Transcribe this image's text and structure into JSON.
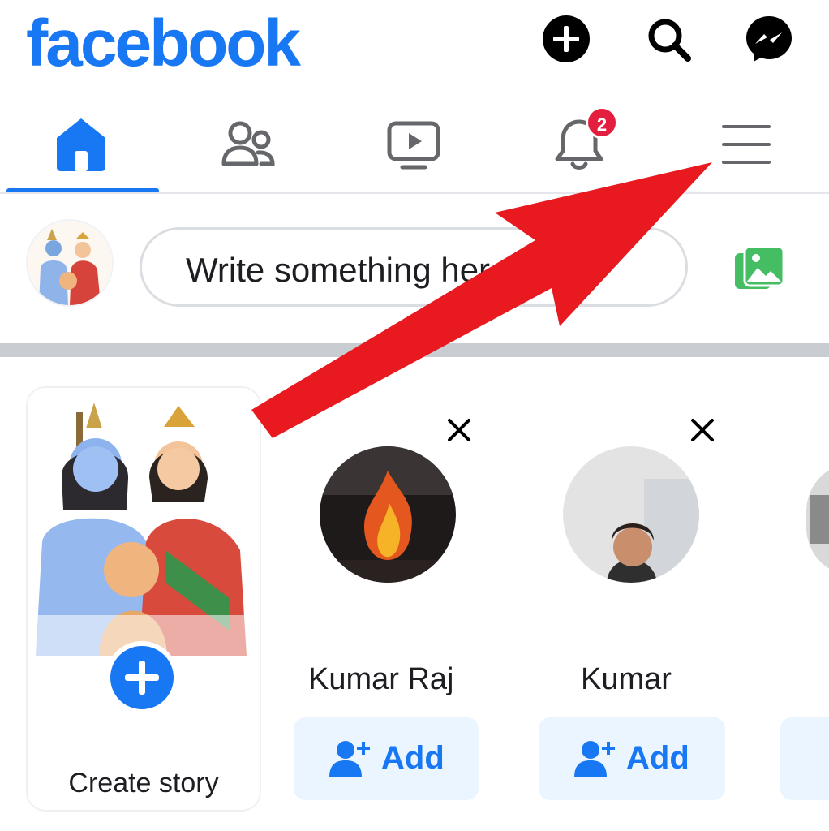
{
  "header": {
    "logo_text": "facebook",
    "create_icon": "plus-circle-icon",
    "search_icon": "search-icon",
    "messenger_icon": "messenger-icon"
  },
  "tabs": [
    {
      "name": "home",
      "icon": "home-icon",
      "active": true
    },
    {
      "name": "friends",
      "icon": "friends-icon",
      "active": false
    },
    {
      "name": "watch",
      "icon": "video-icon",
      "active": false
    },
    {
      "name": "notifications",
      "icon": "bell-icon",
      "active": false,
      "badge": "2"
    },
    {
      "name": "menu",
      "icon": "hamburger-menu-icon",
      "active": false
    }
  ],
  "composer": {
    "placeholder": "Write something here...",
    "photo_icon": "photo-icon"
  },
  "stories": {
    "create_label": "Create story"
  },
  "suggestions": [
    {
      "name": "Kumar Raj",
      "button_label": "Add"
    },
    {
      "name": "Kumar",
      "button_label": "Add"
    }
  ],
  "annotation": {
    "arrow_color": "#e8191f",
    "points_to": "hamburger-menu-icon"
  },
  "colors": {
    "brand": "#1877f2",
    "badge": "#e41e3f",
    "add_button_bg": "#ebf5ff"
  }
}
